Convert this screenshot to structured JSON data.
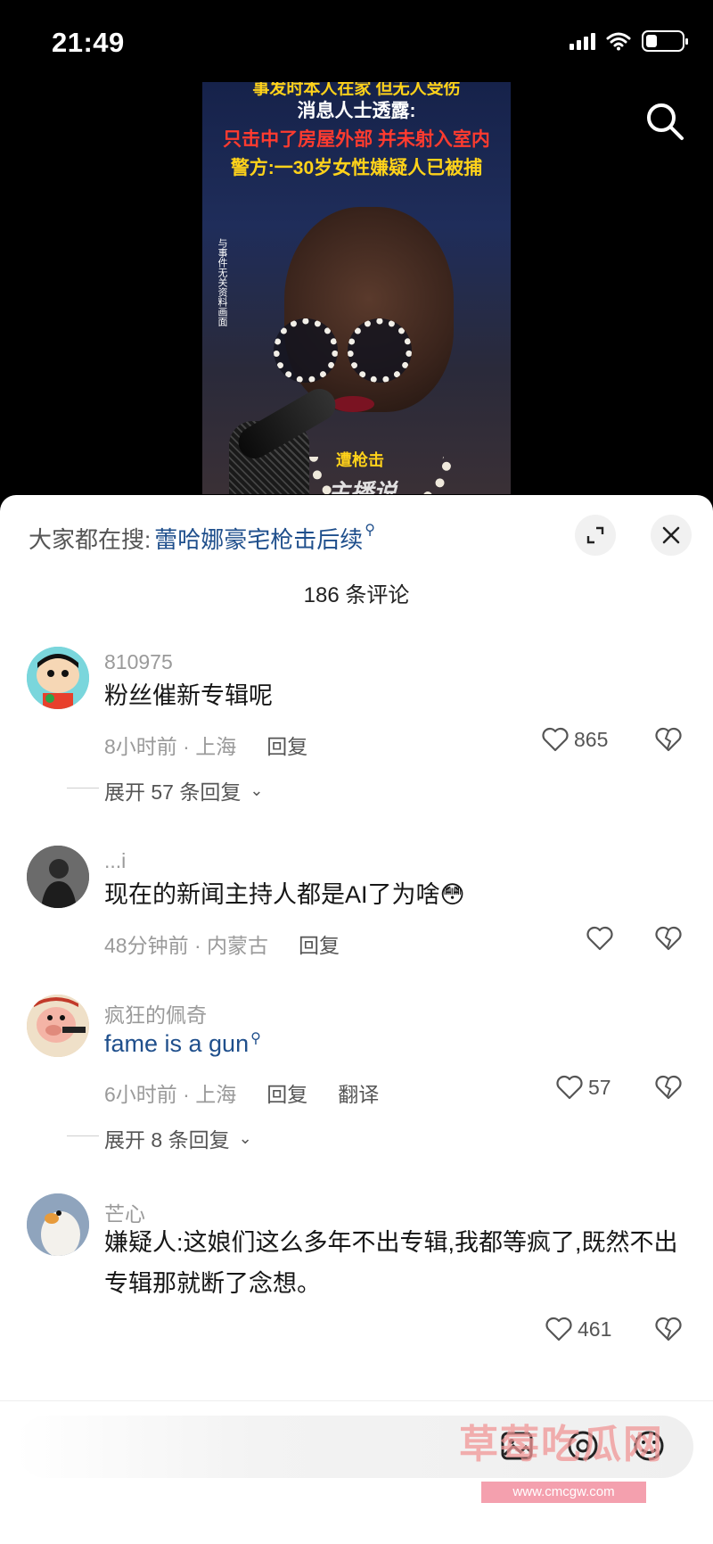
{
  "status_bar": {
    "time": "21:49"
  },
  "video": {
    "caption_top": "事发时本人在家 但无人受伤",
    "caption_line1": "消息人士透露:",
    "caption_line2": "只击中了房屋外部 并未射入室内",
    "caption_line3": "警方:一30岁女性嫌疑人已被捕",
    "side_note": "与事件无关资料画面",
    "label_small": "遭枪击",
    "brand_watermark": "主播说"
  },
  "sheet": {
    "search_prefix": "大家都在搜:",
    "search_keyword": "蕾哈娜豪宅枪击后续",
    "comment_count": "186 条评论"
  },
  "comments": [
    {
      "user": "810975",
      "text": "粉丝催新专辑呢",
      "time_location": "8小时前 · 上海",
      "reply": "回复",
      "likes": "865",
      "expand": "展开 57 条回复"
    },
    {
      "user": "...i",
      "text": "现在的新闻主持人都是AI了为啥😳",
      "time_location": "48分钟前 · 内蒙古",
      "reply": "回复",
      "likes": ""
    },
    {
      "user": "疯狂的佩奇",
      "text": "fame is a gun",
      "time_location": "6小时前 · 上海",
      "reply": "回复",
      "translate": "翻译",
      "likes": "57",
      "expand": "展开 8 条回复"
    },
    {
      "user": "芒心",
      "text": "嫌疑人:这娘们这么多年不出专辑,我都等疯了,既然不出专辑那就断了念想。",
      "time_location": "",
      "likes": "461"
    }
  ],
  "bottom": {
    "site_mark": "草莓吃瓜网",
    "site_url": "www.cmcgw.com"
  },
  "colors": {
    "link": "#1f4f8c",
    "meta": "#9a9a9a",
    "video_bg": "#000000"
  }
}
